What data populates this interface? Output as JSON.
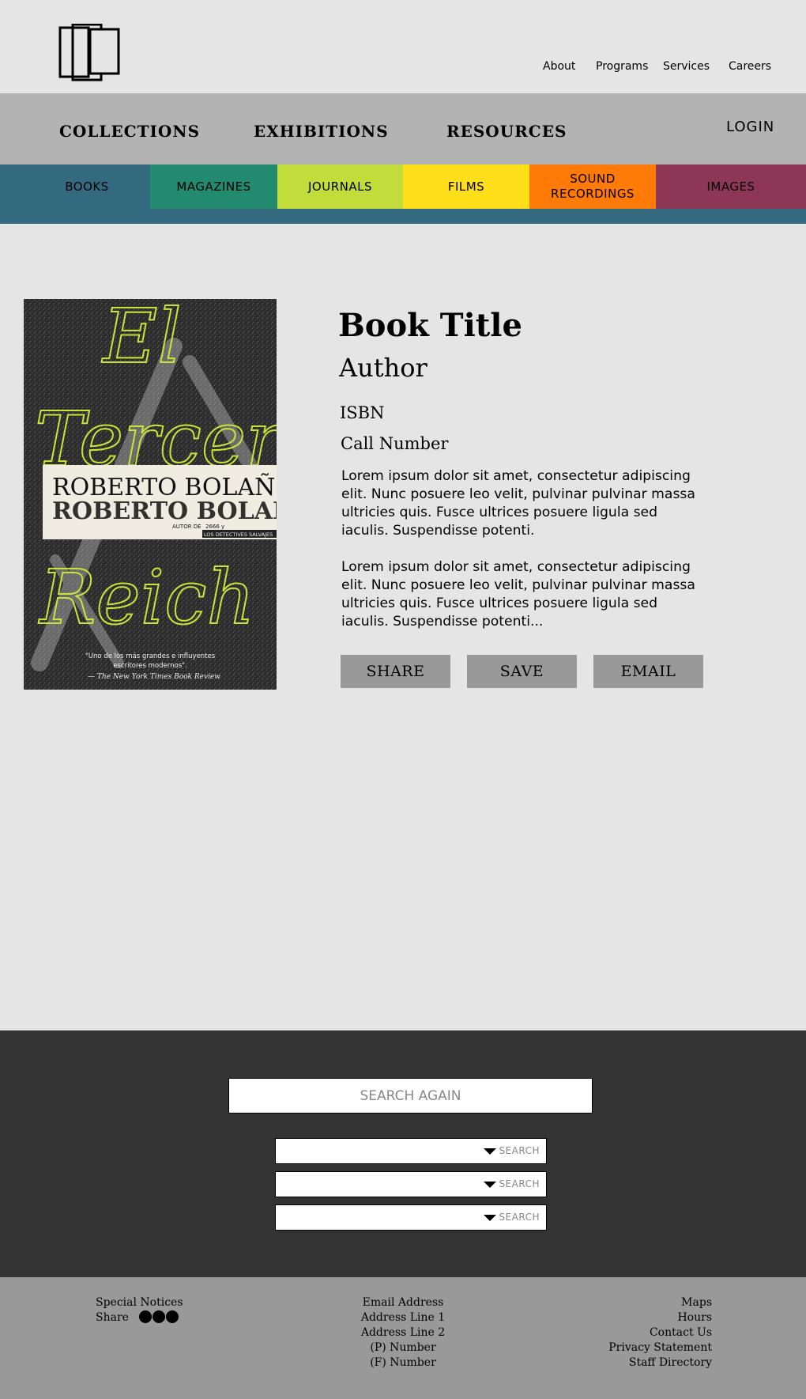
{
  "top_links": [
    "About",
    "Programs",
    "Services",
    "Careers"
  ],
  "main_nav": {
    "items": [
      "COLLECTIONS",
      "EXHIBITIONS",
      "RESOURCES"
    ],
    "login": "LOGIN"
  },
  "categories": [
    {
      "label": "BOOKS",
      "color": "#336a7f"
    },
    {
      "label": "MAGAZINES",
      "color": "#228a6e"
    },
    {
      "label": "JOURNALS",
      "color": "#c2dc3a"
    },
    {
      "label": "FILMS",
      "color": "#ffde1a"
    },
    {
      "label": "SOUND\nRECORDINGS",
      "color": "#ff7a06"
    },
    {
      "label": "IMAGES",
      "color": "#8e3656"
    }
  ],
  "cover": {
    "title_words": [
      "El",
      "Tercer",
      "Reich"
    ],
    "author": "ROBERTO BOLAÑO",
    "tagline_prefix": "AUTOR DE",
    "tagline_book_a": "2666 y",
    "tagline_book_b": "LOS DETECTIVES SALVAJES",
    "quote_line_1": "\"Uno de los más grandes e influyentes",
    "quote_line_2": "escritores modernos\".",
    "quote_source": "— The New York Times Book Review",
    "accent_color": "#c6e43a"
  },
  "book": {
    "title": "Book Title",
    "author": "Author",
    "isbn": "ISBN",
    "call_number": "Call Number",
    "description_1": "Lorem ipsum dolor sit amet, consectetur adipiscing elit. Nunc posuere leo velit, pulvinar pulvinar massa ultricies quis. Fusce ultrices posuere ligula sed iaculis. Suspendisse potenti.",
    "description_2": "Lorem ipsum dolor sit amet, consectetur adipiscing elit. Nunc posuere leo velit, pulvinar pulvinar massa ultricies quis. Fusce ultrices posuere ligula sed iaculis. Suspendisse potenti..."
  },
  "actions": [
    "SHARE",
    "SAVE",
    "EMAIL"
  ],
  "search": {
    "again_label": "SEARCH AGAIN",
    "dropdown_labels": [
      "SEARCH",
      "SEARCH",
      "SEARCH"
    ]
  },
  "footer": {
    "special_notices": "Special Notices",
    "share_label": "Share",
    "contact": [
      "Email Address",
      "Address Line 1",
      "Address Line 2",
      "(P) Number",
      "(F) Number"
    ],
    "links": [
      "Maps",
      "Hours",
      "Contact Us",
      "Privacy Statement",
      "Staff Directory"
    ]
  },
  "colors": {
    "top_bg": "#e5e5e5",
    "nav_bg": "#b3b3b3",
    "search_bg": "#333333",
    "footer_bg": "#999999",
    "button_bg": "#999999"
  }
}
